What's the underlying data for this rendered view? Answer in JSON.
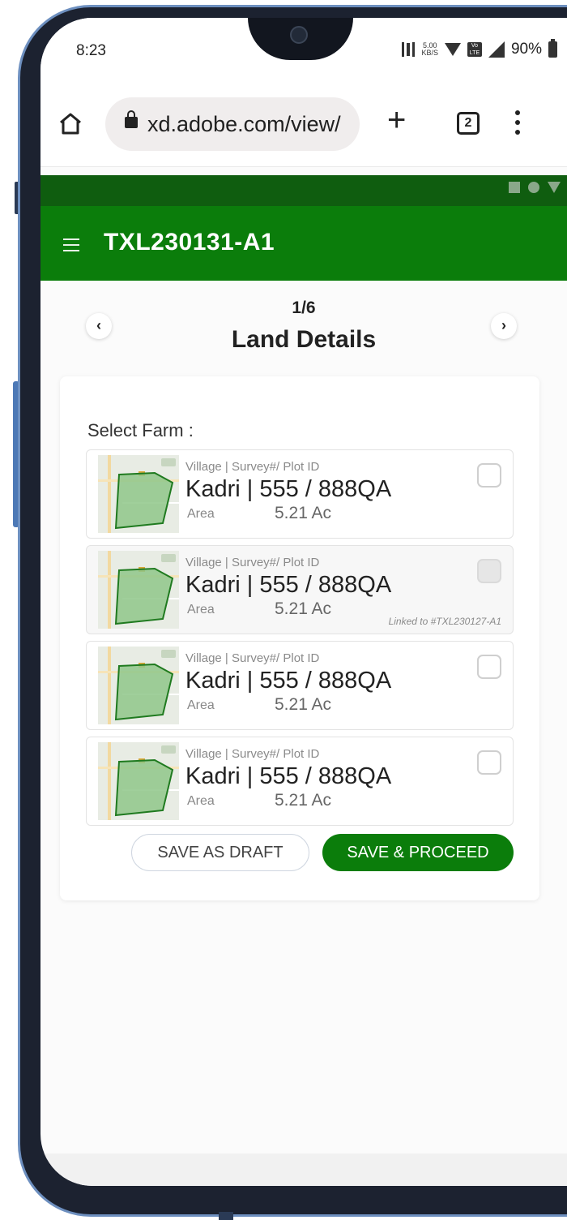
{
  "status_bar": {
    "time": "8:23",
    "speed_top": "5.00",
    "speed_unit": "KB/S",
    "network_badge": "Vo LTE",
    "battery": "90%"
  },
  "browser": {
    "url": "xd.adobe.com/view/",
    "tab_count": "2"
  },
  "app": {
    "title": "TXL230131-A1",
    "accent_color": "#0b7d0b",
    "header_dark_color": "#0f5d0f"
  },
  "step": {
    "counter": "1/6",
    "title": "Land Details",
    "prev_symbol": "‹",
    "next_symbol": "›"
  },
  "form": {
    "select_label": "Select Farm :",
    "farms": [
      {
        "subtitle": "Village | Survey#/ Plot ID",
        "main": "Kadri | 555 / 888QA",
        "area_label": "Area",
        "area_value": "5.21 Ac",
        "checked": false,
        "disabled": false,
        "linked_note": ""
      },
      {
        "subtitle": "Village | Survey#/ Plot ID",
        "main": "Kadri | 555 / 888QA",
        "area_label": "Area",
        "area_value": "5.21 Ac",
        "checked": false,
        "disabled": true,
        "linked_note": "Linked to #TXL230127-A1"
      },
      {
        "subtitle": "Village | Survey#/ Plot ID",
        "main": "Kadri | 555 / 888QA",
        "area_label": "Area",
        "area_value": "5.21 Ac",
        "checked": false,
        "disabled": false,
        "linked_note": ""
      },
      {
        "subtitle": "Village | Survey#/ Plot ID",
        "main": "Kadri | 555 / 888QA",
        "area_label": "Area",
        "area_value": "5.21 Ac",
        "checked": false,
        "disabled": false,
        "linked_note": ""
      }
    ],
    "save_draft_label": "SAVE AS DRAFT",
    "save_proceed_label": "SAVE & PROCEED"
  }
}
